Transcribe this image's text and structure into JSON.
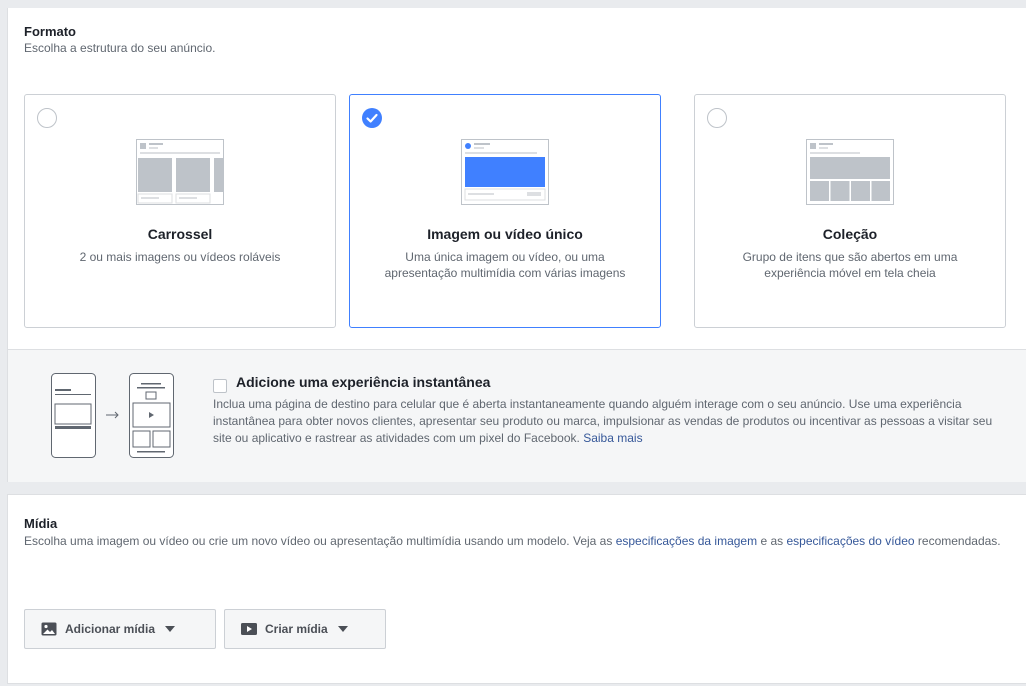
{
  "format": {
    "title": "Formato",
    "subtitle": "Escolha a estrutura do seu anúncio.",
    "cards": [
      {
        "name": "Carrossel",
        "description": "2 ou mais imagens ou vídeos roláveis",
        "selected": false,
        "icon": "carousel-illustration"
      },
      {
        "name": "Imagem ou vídeo único",
        "description": "Uma única imagem ou vídeo, ou uma apresentação multimídia com várias imagens",
        "selected": true,
        "icon": "single-image-illustration"
      },
      {
        "name": "Coleção",
        "description": "Grupo de itens que são abertos em uma experiência móvel em tela cheia",
        "selected": false,
        "icon": "collection-illustration"
      }
    ]
  },
  "instant_experience": {
    "title": "Adicione uma experiência instantânea",
    "description": "Inclua uma página de destino para celular que é aberta instantaneamente quando alguém interage com o seu anúncio. Use uma experiência instantânea para obter novos clientes, apresentar seu produto ou marca, impulsionar as vendas de produtos ou incentivar as pessoas a visitar seu site ou aplicativo e rastrear as atividades com um pixel do Facebook.",
    "link": "Saiba mais",
    "checked": false
  },
  "media": {
    "title": "Mídia",
    "subtitle_before": "Escolha uma imagem ou vídeo ou crie um novo vídeo ou apresentação multimídia usando um modelo. Veja as",
    "link_image_specs": "especificações da imagem",
    "subtitle_middle": "e as",
    "link_video_specs": "especificações do vídeo",
    "subtitle_after": "recomendadas.",
    "add_media_label": "Adicionar mídia",
    "create_media_label": "Criar mídia"
  },
  "colors": {
    "accent": "#4080ff",
    "link": "#365899",
    "muted": "#606770"
  }
}
